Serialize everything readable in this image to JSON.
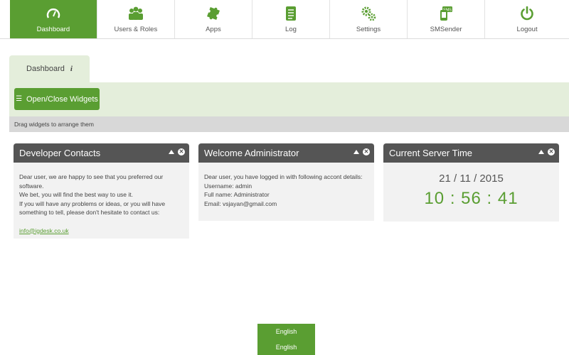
{
  "nav": [
    {
      "label": "Dashboard",
      "icon": "gauge-icon",
      "active": true
    },
    {
      "label": "Users & Roles",
      "icon": "users-icon",
      "active": false
    },
    {
      "label": "Apps",
      "icon": "puzzle-icon",
      "active": false
    },
    {
      "label": "Log",
      "icon": "log-icon",
      "active": false
    },
    {
      "label": "Settings",
      "icon": "gears-icon",
      "active": false
    },
    {
      "label": "SMSender",
      "icon": "sms-icon",
      "active": false
    },
    {
      "label": "Logout",
      "icon": "power-icon",
      "active": false
    }
  ],
  "tab": {
    "label": "Dashboard",
    "info": "i"
  },
  "toolbar": {
    "toggle_label": "Open/Close Widgets"
  },
  "hint": "Drag widgets to arrange them",
  "widgets": {
    "contacts": {
      "title": "Developer Contacts",
      "lines": [
        "Dear user, we are happy to see that you preferred our software.",
        "We bet, you will find the best way to use it.",
        "If you will have any problems or ideas, or you will have something to tell, please don't hesitate to contact us:"
      ],
      "email": "info@igdesk.co.uk"
    },
    "welcome": {
      "title": "Welcome Administrator",
      "intro": "Dear user, you have logged in with following accont details:",
      "username": "Username: admin",
      "fullname": "Full name: Administrator",
      "email": "Email: vsjayan@gmail.com"
    },
    "time": {
      "title": "Current Server Time",
      "date": "21 / 11 / 2015",
      "clock": "10 : 56 : 41"
    }
  },
  "language": {
    "options": [
      "English",
      "English"
    ]
  },
  "colors": {
    "accent": "#5a9e32",
    "widget_header": "#555555",
    "panel_bg": "#e4eedb"
  }
}
